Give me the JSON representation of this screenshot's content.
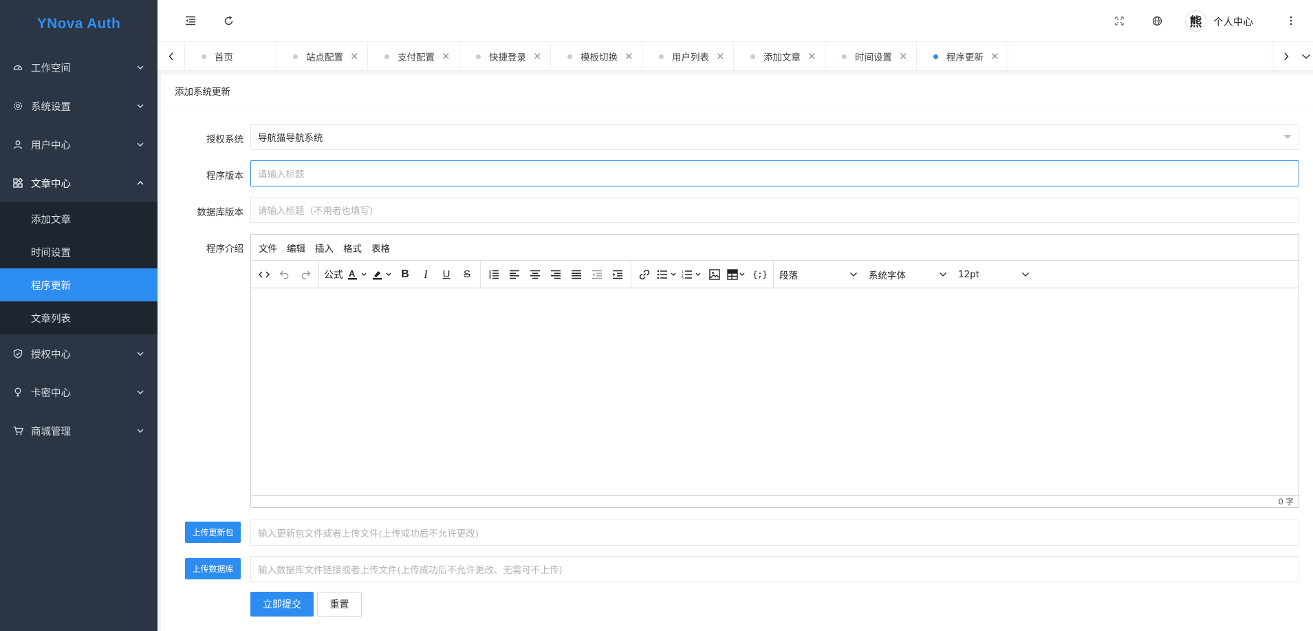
{
  "app": {
    "title": "YNova Auth",
    "accent_color": "#2d8cf0",
    "sidebar_color": "#2b3544"
  },
  "sidebar": {
    "items": [
      {
        "label": "工作空间",
        "icon": "dashboard-icon"
      },
      {
        "label": "系统设置",
        "icon": "gear-icon"
      },
      {
        "label": "用户中心",
        "icon": "user-icon"
      },
      {
        "label": "文章中心",
        "icon": "apps-icon",
        "expanded": true,
        "children": [
          {
            "label": "添加文章"
          },
          {
            "label": "时间设置"
          },
          {
            "label": "程序更新",
            "active": true
          },
          {
            "label": "文章列表"
          }
        ]
      },
      {
        "label": "授权中心",
        "icon": "shield-icon"
      },
      {
        "label": "卡密中心",
        "icon": "bulb-icon"
      },
      {
        "label": "商城管理",
        "icon": "cart-icon"
      }
    ]
  },
  "topbar": {
    "user_label": "个人中心",
    "avatar_char": "熊"
  },
  "tabs": [
    {
      "label": "首页",
      "closable": false
    },
    {
      "label": "站点配置",
      "closable": true
    },
    {
      "label": "支付配置",
      "closable": true
    },
    {
      "label": "快捷登录",
      "closable": true
    },
    {
      "label": "模板切换",
      "closable": true
    },
    {
      "label": "用户列表",
      "closable": true
    },
    {
      "label": "添加文章",
      "closable": true
    },
    {
      "label": "时间设置",
      "closable": true
    },
    {
      "label": "程序更新",
      "closable": true,
      "active": true
    }
  ],
  "page": {
    "header": "添加系统更新",
    "form": {
      "auth_system": {
        "label": "授权系统",
        "value": "导航猫导航系统"
      },
      "program_version": {
        "label": "程序版本",
        "placeholder": "请输入标题"
      },
      "db_version": {
        "label": "数据库版本",
        "placeholder": "请输入标题（不用者也填写）"
      },
      "intro": {
        "label": "程序介绍"
      },
      "upload_package": {
        "button": "上传更新包",
        "placeholder": "输入更新包文件或者上传文件(上传成功后不允许更改)"
      },
      "upload_db": {
        "button": "上传数据库",
        "placeholder": "输入数据库文件链接或者上传文件(上传成功后不允许更改、无需可不上传)"
      },
      "submit": "立即提交",
      "reset": "重置"
    },
    "editor": {
      "menubar": [
        "文件",
        "编辑",
        "插入",
        "格式",
        "表格"
      ],
      "formula_label": "公式",
      "block_format": "段落",
      "font_family": "系统字体",
      "font_size": "12pt",
      "word_count": "0 字"
    }
  }
}
